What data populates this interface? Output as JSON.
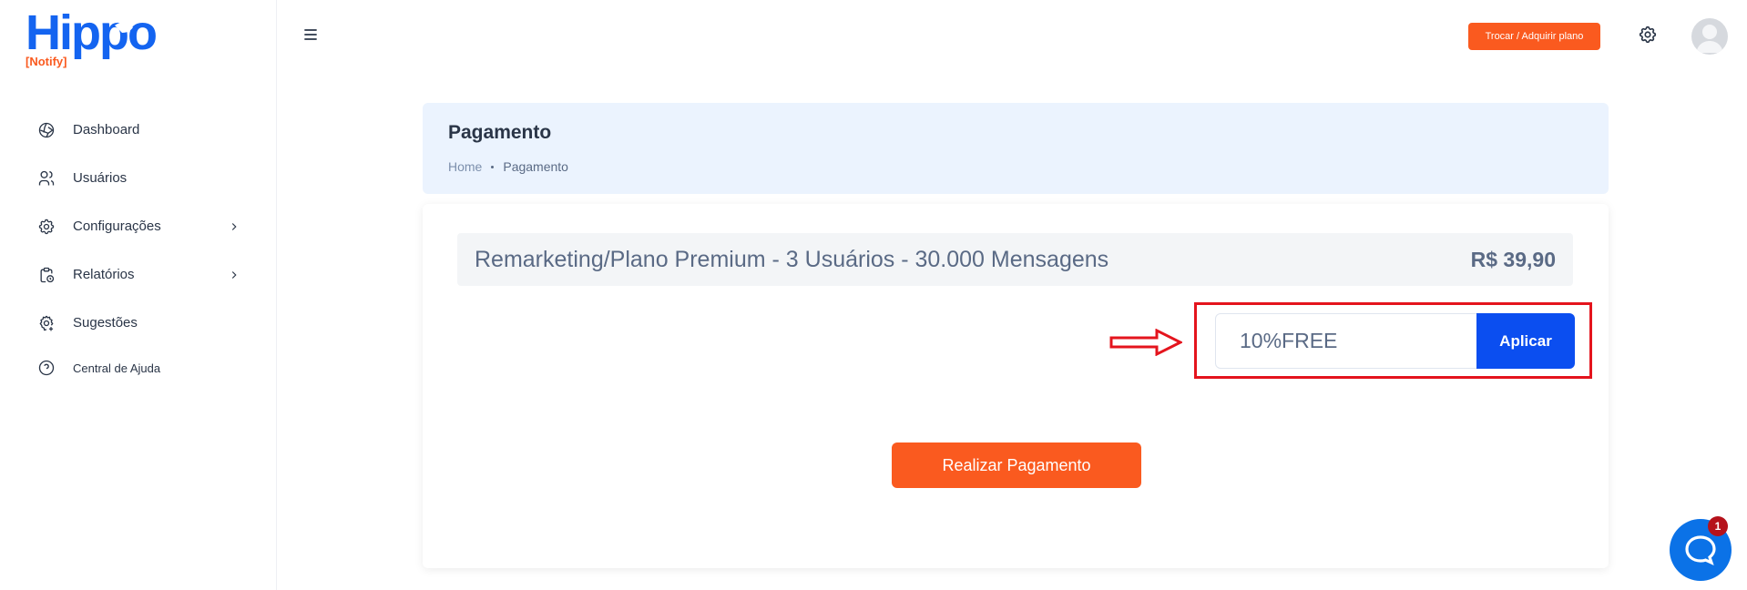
{
  "app": {
    "logo_name": "Hippo",
    "logo_sub": "[Notify]"
  },
  "sidebar": {
    "items": [
      {
        "label": "Dashboard",
        "icon": "aperture-icon"
      },
      {
        "label": "Usuários",
        "icon": "users-icon"
      },
      {
        "label": "Configurações",
        "icon": "gear-icon",
        "has_submenu": true
      },
      {
        "label": "Relatórios",
        "icon": "clipboard-clock-icon",
        "has_submenu": true
      },
      {
        "label": "Sugestões",
        "icon": "gear-plus-icon"
      },
      {
        "label": "Central de Ajuda",
        "icon": "help-circle-icon"
      }
    ]
  },
  "topbar": {
    "plan_button": "Trocar / Adquirir plano"
  },
  "header": {
    "title": "Pagamento",
    "breadcrumb_home": "Home",
    "breadcrumb_current": "Pagamento"
  },
  "payment": {
    "plan_description": "Remarketing/Plano Premium - 3 Usuários - 30.000 Mensagens",
    "plan_price": "R$ 39,90",
    "coupon_value": "10%FREE",
    "apply_label": "Aplicar",
    "pay_label": "Realizar Pagamento"
  },
  "chat": {
    "badge_count": "1"
  },
  "colors": {
    "accent_orange": "#fa5a1f",
    "primary_blue": "#0b4ef0",
    "highlight_red": "#e4141d",
    "header_bg": "#ebf3fe"
  }
}
